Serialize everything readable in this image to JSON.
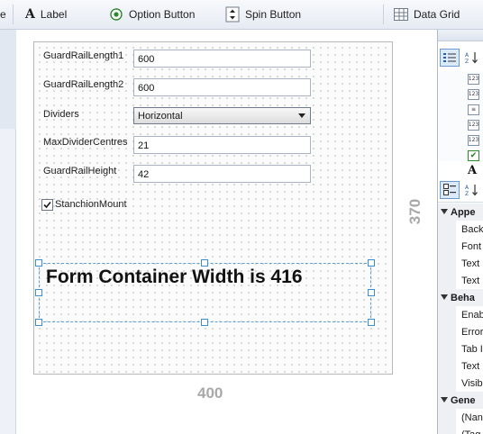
{
  "toolbar": {
    "items": [
      {
        "label": "e",
        "icon": "partial-item"
      },
      {
        "label": "Label",
        "icon": "label-a-icon"
      },
      {
        "label": "Option Button",
        "icon": "option-button-icon"
      },
      {
        "label": "Spin Button",
        "icon": "spin-button-icon"
      },
      {
        "label": "Data Grid",
        "icon": "data-grid-icon"
      }
    ]
  },
  "form": {
    "fields": [
      {
        "label": "GuardRailLength1",
        "value": "600"
      },
      {
        "label": "GuardRailLength2",
        "value": "600"
      },
      {
        "label": "Dividers",
        "value": "Horizontal"
      },
      {
        "label": "MaxDividerCentres",
        "value": "21"
      },
      {
        "label": "GuardRailHeight",
        "value": "42"
      }
    ],
    "checkbox": {
      "label": "StanchionMount",
      "checked": true
    },
    "selected_label_text": "Form Container Width is 416",
    "width_label": "400",
    "height_label": "370"
  },
  "toolbox": {
    "items": [
      {
        "icon": "textbox-123-icon",
        "glyph": "123"
      },
      {
        "icon": "textbox-123-icon",
        "glyph": "123"
      },
      {
        "icon": "combo-box-icon",
        "glyph": "≡"
      },
      {
        "icon": "textbox-123-icon",
        "glyph": "123"
      },
      {
        "icon": "textbox-123-icon",
        "glyph": "123"
      },
      {
        "icon": "checkbox-icon",
        "glyph": "✔"
      },
      {
        "icon": "label-a-icon",
        "glyph": "A"
      }
    ]
  },
  "properties": {
    "rows": [
      {
        "type": "category",
        "text": "Appe"
      },
      {
        "type": "prop",
        "text": "Back"
      },
      {
        "type": "prop",
        "text": "Font"
      },
      {
        "type": "prop",
        "text": "Text"
      },
      {
        "type": "prop",
        "text": "Text"
      },
      {
        "type": "category",
        "text": "Beha"
      },
      {
        "type": "prop",
        "text": "Enab"
      },
      {
        "type": "prop",
        "text": "Error"
      },
      {
        "type": "prop",
        "text": "Tab I"
      },
      {
        "type": "prop",
        "text": "Text"
      },
      {
        "type": "prop",
        "text": "Visib"
      },
      {
        "type": "category",
        "text": "Gene"
      },
      {
        "type": "prop",
        "text": "(Nan"
      },
      {
        "type": "prop",
        "text": "(Tag"
      }
    ]
  },
  "colors": {
    "selection": "#3b8fd0",
    "dimension_text": "#a8a8a8"
  }
}
